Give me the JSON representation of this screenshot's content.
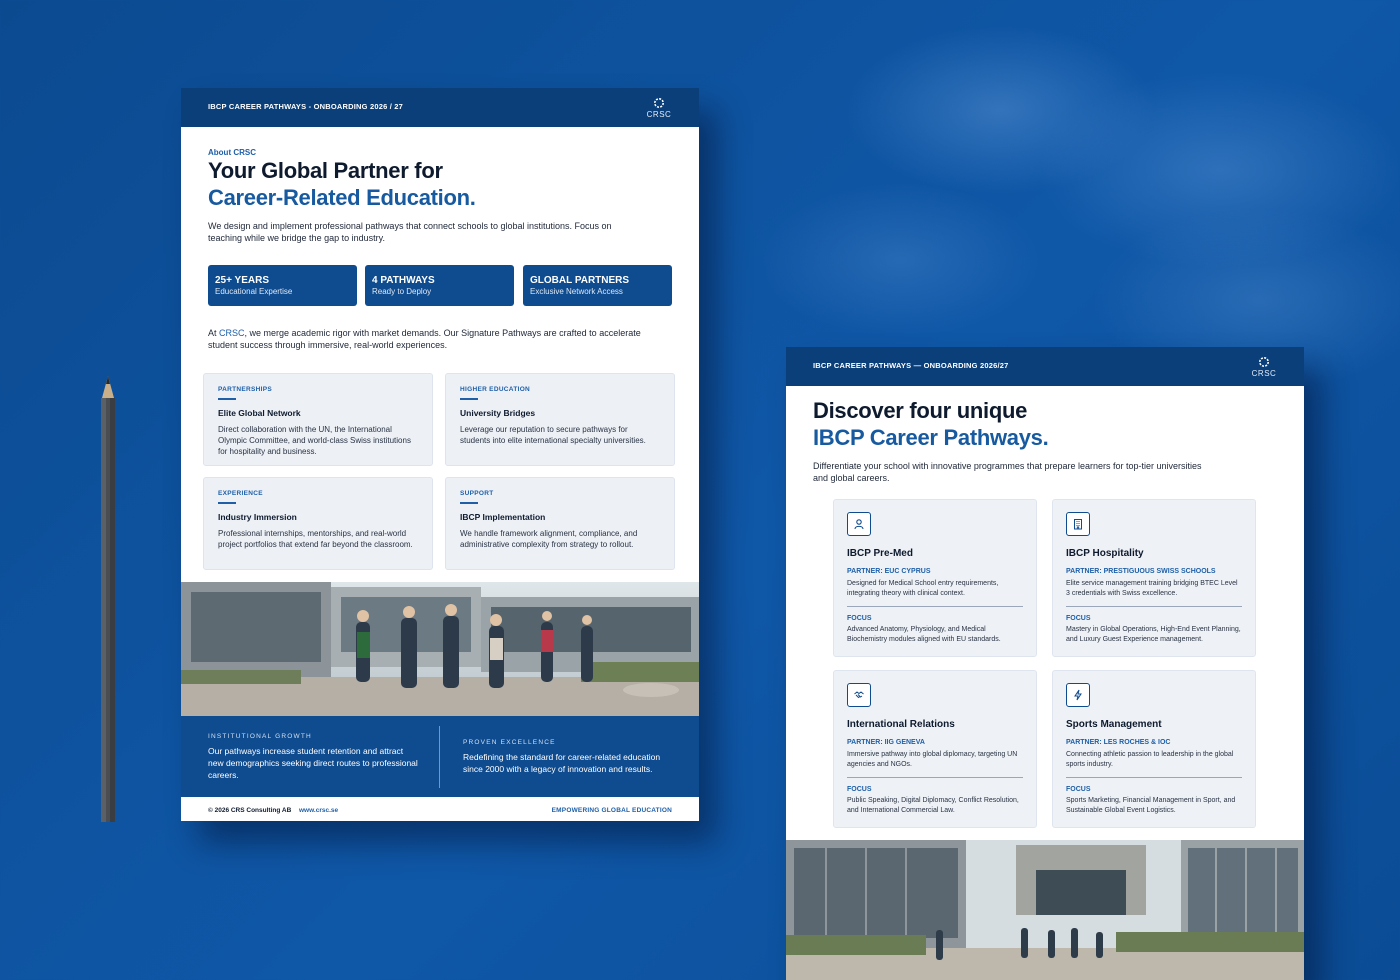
{
  "brand": {
    "logo_text": "CRSC",
    "primary_color": "#0b3f7a",
    "accent_color": "#175aa0",
    "background_color": "#0d4f98"
  },
  "left_sheet": {
    "header_title": "IBCP CAREER PATHWAYS - ONBOARDING 2026 / 27",
    "eyebrow": "About CRSC",
    "headline_line1": "Your Global Partner for",
    "headline_line2": "Career-Related Education.",
    "intro_line1": "We design and implement professional pathways that connect schools to global institutions. Focus on",
    "intro_line2": "teaching while we bridge the gap to industry.",
    "stats": [
      {
        "value": "25+ YEARS",
        "label": "Educational Expertise"
      },
      {
        "value": "4 PATHWAYS",
        "label": "Ready to Deploy"
      },
      {
        "value": "GLOBAL PARTNERS",
        "label": "Exclusive Network Access"
      }
    ],
    "mission_prefix": "At ",
    "mission_link": "CRSC",
    "mission_rest_line1": ", we merge academic rigor with market demands. Our Signature Pathways are crafted to accelerate",
    "mission_line2": "student success through immersive, real-world experiences.",
    "cards": [
      {
        "kicker": "PARTNERSHIPS",
        "title": "Elite Global Network",
        "desc": "Direct collaboration with the UN, the International Olympic Committee, and world-class Swiss institutions for hospitality and business."
      },
      {
        "kicker": "HIGHER EDUCATION",
        "title": "University Bridges",
        "desc": "Leverage our reputation to secure pathways for students into elite international specialty universities."
      },
      {
        "kicker": "EXPERIENCE",
        "title": "Industry Immersion",
        "desc": "Professional internships, mentorships, and real-world project portfolios that extend far beyond the classroom."
      },
      {
        "kicker": "SUPPORT",
        "title": "IBCP Implementation",
        "desc": "We handle framework alignment, compliance, and administrative complexity from strategy to rollout."
      }
    ],
    "panel": [
      {
        "kicker": "INSTITUTIONAL GROWTH",
        "text": "Our pathways increase student retention and attract new demographics seeking direct routes to professional careers."
      },
      {
        "kicker": "PROVEN EXCELLENCE",
        "text": "Redefining the standard for career-related education since 2000 with a legacy of innovation and results."
      }
    ],
    "footer_copyright": "© 2026 CRS Consulting AB",
    "footer_url": "www.crsc.se",
    "footer_tagline": "EMPOWERING GLOBAL EDUCATION"
  },
  "right_sheet": {
    "header_title": "IBCP CAREER PATHWAYS — ONBOARDING 2026/27",
    "headline_line1": "Discover four unique",
    "headline_line2": "IBCP Career Pathways.",
    "intro_line1": "Differentiate your school with innovative programmes that prepare learners for top-tier universities",
    "intro_line2": "and global careers.",
    "focus_label": "FOCUS",
    "pathways": [
      {
        "icon": "person-icon",
        "name": "IBCP Pre-Med",
        "partner": "PARTNER: EUC CYPRUS",
        "desc": "Designed for Medical School entry requirements, integrating theory with clinical context.",
        "focus": "Advanced Anatomy, Physiology, and Medical Biochemistry modules aligned with EU standards."
      },
      {
        "icon": "building-icon",
        "name": "IBCP Hospitality",
        "partner": "PARTNER: PRESTIGUOUS SWISS SCHOOLS",
        "desc": "Elite service management training bridging BTEC Level 3 credentials with Swiss excellence.",
        "focus": "Mastery in Global Operations, High-End Event Planning, and Luxury Guest Experience management."
      },
      {
        "icon": "handshake-icon",
        "name": "International Relations",
        "partner": "PARTNER: IIG GENEVA",
        "desc": "Immersive pathway into global diplomacy, targeting UN agencies and NGOs.",
        "focus": "Public Speaking, Digital Diplomacy, Conflict Resolution, and International Commercial Law."
      },
      {
        "icon": "bolt-icon",
        "name": "Sports Management",
        "partner": "PARTNER: LES ROCHES & IOC",
        "desc": "Connecting athletic passion to leadership in the global sports industry.",
        "focus": "Sports Marketing, Financial Management in Sport, and Sustainable Global Event Logistics."
      }
    ]
  }
}
